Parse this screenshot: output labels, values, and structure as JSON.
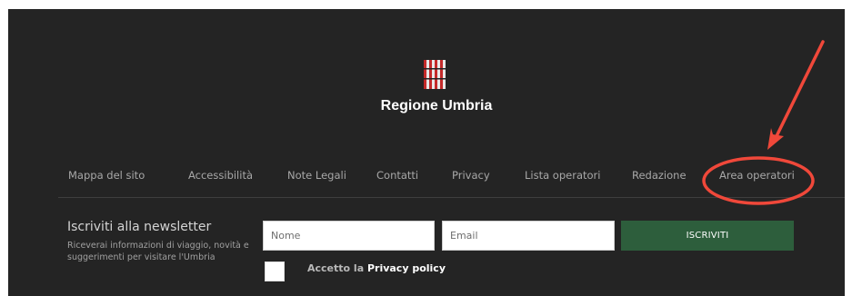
{
  "header": {
    "region_name": "Regione Umbria",
    "logo_icon": "umbria-logo-icon"
  },
  "footer_nav": [
    {
      "label": "Mappa del sito"
    },
    {
      "label": "Accessibilità"
    },
    {
      "label": "Note Legali"
    },
    {
      "label": "Contatti"
    },
    {
      "label": "Privacy"
    },
    {
      "label": "Lista operatori"
    },
    {
      "label": "Redazione"
    },
    {
      "label": "Area operatori"
    }
  ],
  "newsletter": {
    "title": "Iscriviti alla newsletter",
    "description": "Riceverai informazioni di viaggio, novità e suggerimenti per visitare l'Umbria",
    "name_placeholder": "Nome",
    "email_placeholder": "Email",
    "subscribe_label": "ISCRIVITI",
    "consent_prefix": "Accetto la ",
    "consent_link": "Privacy policy"
  },
  "colors": {
    "background": "#242424",
    "button": "#2d5e3c",
    "annotation": "#f0483a",
    "logo": "#c42a2a"
  }
}
